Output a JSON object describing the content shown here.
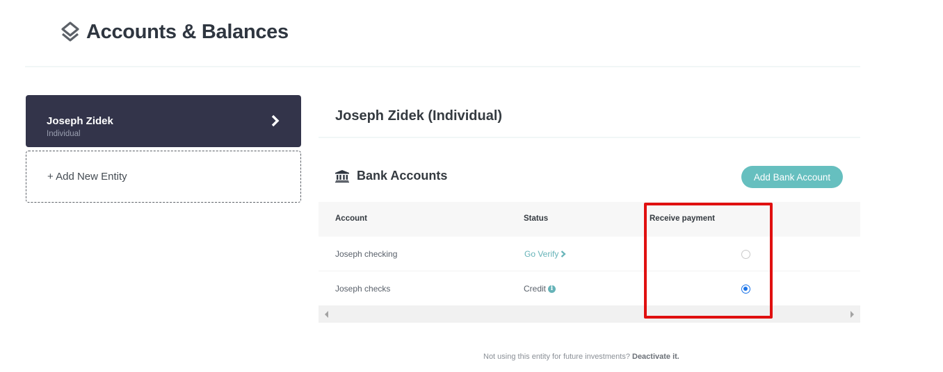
{
  "header": {
    "title": "Accounts & Balances",
    "icon": "layers-icon"
  },
  "sidebar": {
    "entities": [
      {
        "name": "Joseph Zidek",
        "type": "Individual",
        "selected": true,
        "icon": "chevron-right-icon"
      }
    ],
    "add_entity_label": "+ Add New Entity"
  },
  "main": {
    "entity_heading": "Joseph Zidek (Individual)",
    "section": {
      "title": "Bank Accounts",
      "icon": "bank-icon",
      "add_button_label": "Add Bank Account"
    },
    "table": {
      "columns": [
        "Account",
        "Status",
        "Receive payment"
      ],
      "rows": [
        {
          "account": "Joseph checking",
          "status": "Go Verify",
          "status_kind": "link",
          "status_icon": "chevron-right-icon",
          "receive_payment": false
        },
        {
          "account": "Joseph checks",
          "status": "Credit",
          "status_kind": "text",
          "status_icon": "info-icon",
          "receive_payment": true
        }
      ]
    }
  },
  "footer": {
    "note": "Not using this entity for future investments?",
    "link_label": "Deactivate it."
  },
  "colors": {
    "accent": "#66bfbf",
    "entity_card_bg": "#33344a",
    "highlight": "#e01010",
    "radio_selected": "#1a73e8"
  }
}
